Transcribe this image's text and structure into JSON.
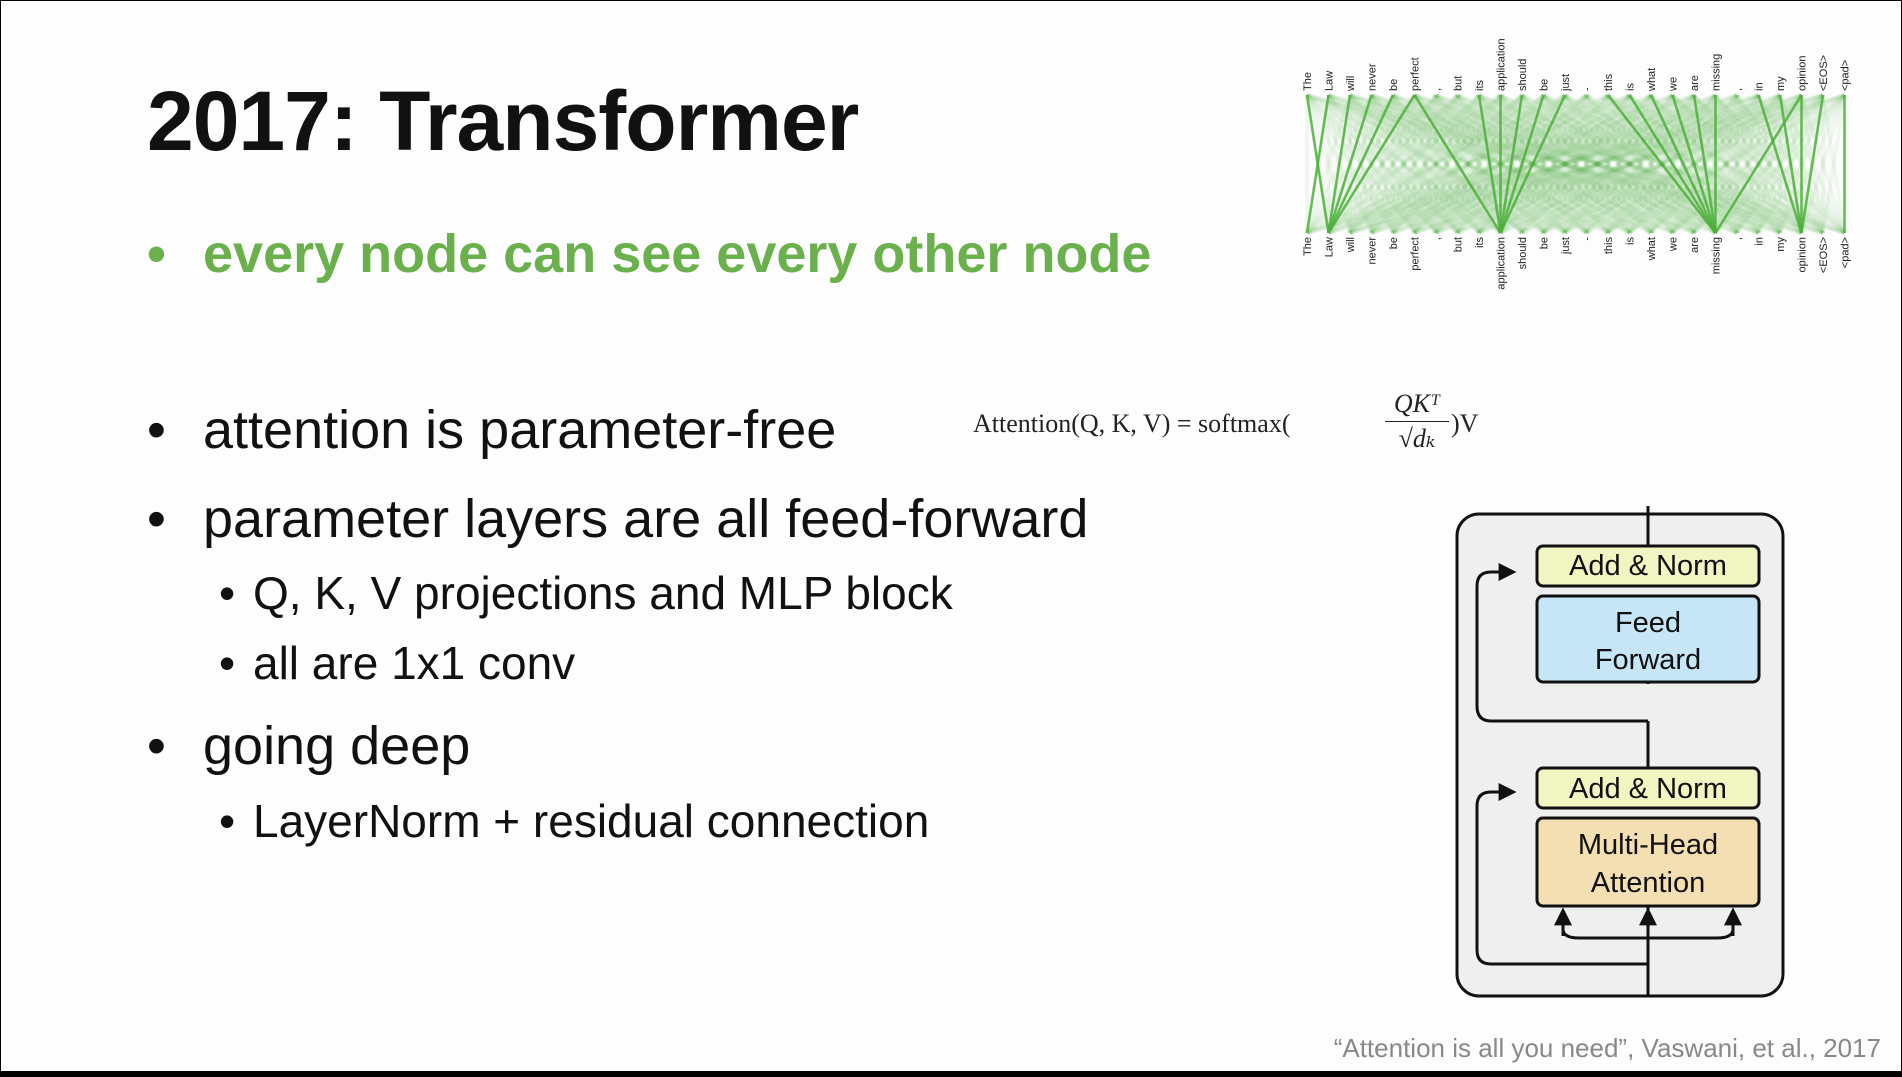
{
  "slide": {
    "title": "2017: Transformer",
    "bullets": [
      {
        "text": "every node can see every other node",
        "highlight": true
      },
      {
        "text": "attention is parameter-free"
      },
      {
        "text": "parameter layers are all feed-forward",
        "subs": [
          "Q, K, V projections and MLP block",
          "all are 1x1 conv"
        ]
      },
      {
        "text": "going deep",
        "subs": [
          "LayerNorm + residual connection"
        ]
      }
    ],
    "bullet_glyph": "•",
    "accent_color": "#6ab04c",
    "formula": {
      "lhs": "Attention(Q, K, V) = softmax(",
      "numerator": "QKᵀ",
      "denominator": "√dₖ",
      "rhs": ")V"
    },
    "attention_viz": {
      "tokens": [
        "The",
        "Law",
        "will",
        "never",
        "be",
        "perfect",
        ",",
        "but",
        "its",
        "application",
        "should",
        "be",
        "just",
        "-",
        "this",
        "is",
        "what",
        "we",
        "are",
        "missing",
        ",",
        "in",
        "my",
        "opinion",
        "<EOS>",
        "<pad>"
      ],
      "strong_links": [
        [
          0,
          1
        ],
        [
          1,
          0
        ],
        [
          2,
          1
        ],
        [
          3,
          1
        ],
        [
          4,
          1
        ],
        [
          5,
          1
        ],
        [
          5,
          9
        ],
        [
          8,
          9
        ],
        [
          9,
          9
        ],
        [
          10,
          9
        ],
        [
          11,
          9
        ],
        [
          12,
          9
        ],
        [
          14,
          19
        ],
        [
          15,
          19
        ],
        [
          16,
          19
        ],
        [
          17,
          19
        ],
        [
          18,
          19
        ],
        [
          19,
          19
        ],
        [
          21,
          23
        ],
        [
          22,
          23
        ],
        [
          23,
          23
        ],
        [
          23,
          19
        ],
        [
          25,
          25
        ],
        [
          24,
          23
        ]
      ],
      "color": "#4caf3a"
    },
    "block_diagram": {
      "top_norm": "Add & Norm",
      "ffn_line1": "Feed",
      "ffn_line2": "Forward",
      "bottom_norm": "Add & Norm",
      "mha_line1": "Multi-Head",
      "mha_line2": "Attention",
      "colors": {
        "norm": "#f1f5c2",
        "ffn": "#c6e6f7",
        "mha": "#f4dfb3",
        "frame": "#efeff0"
      }
    },
    "citation": "“Attention is all you need”, Vaswani, et al., 2017"
  }
}
